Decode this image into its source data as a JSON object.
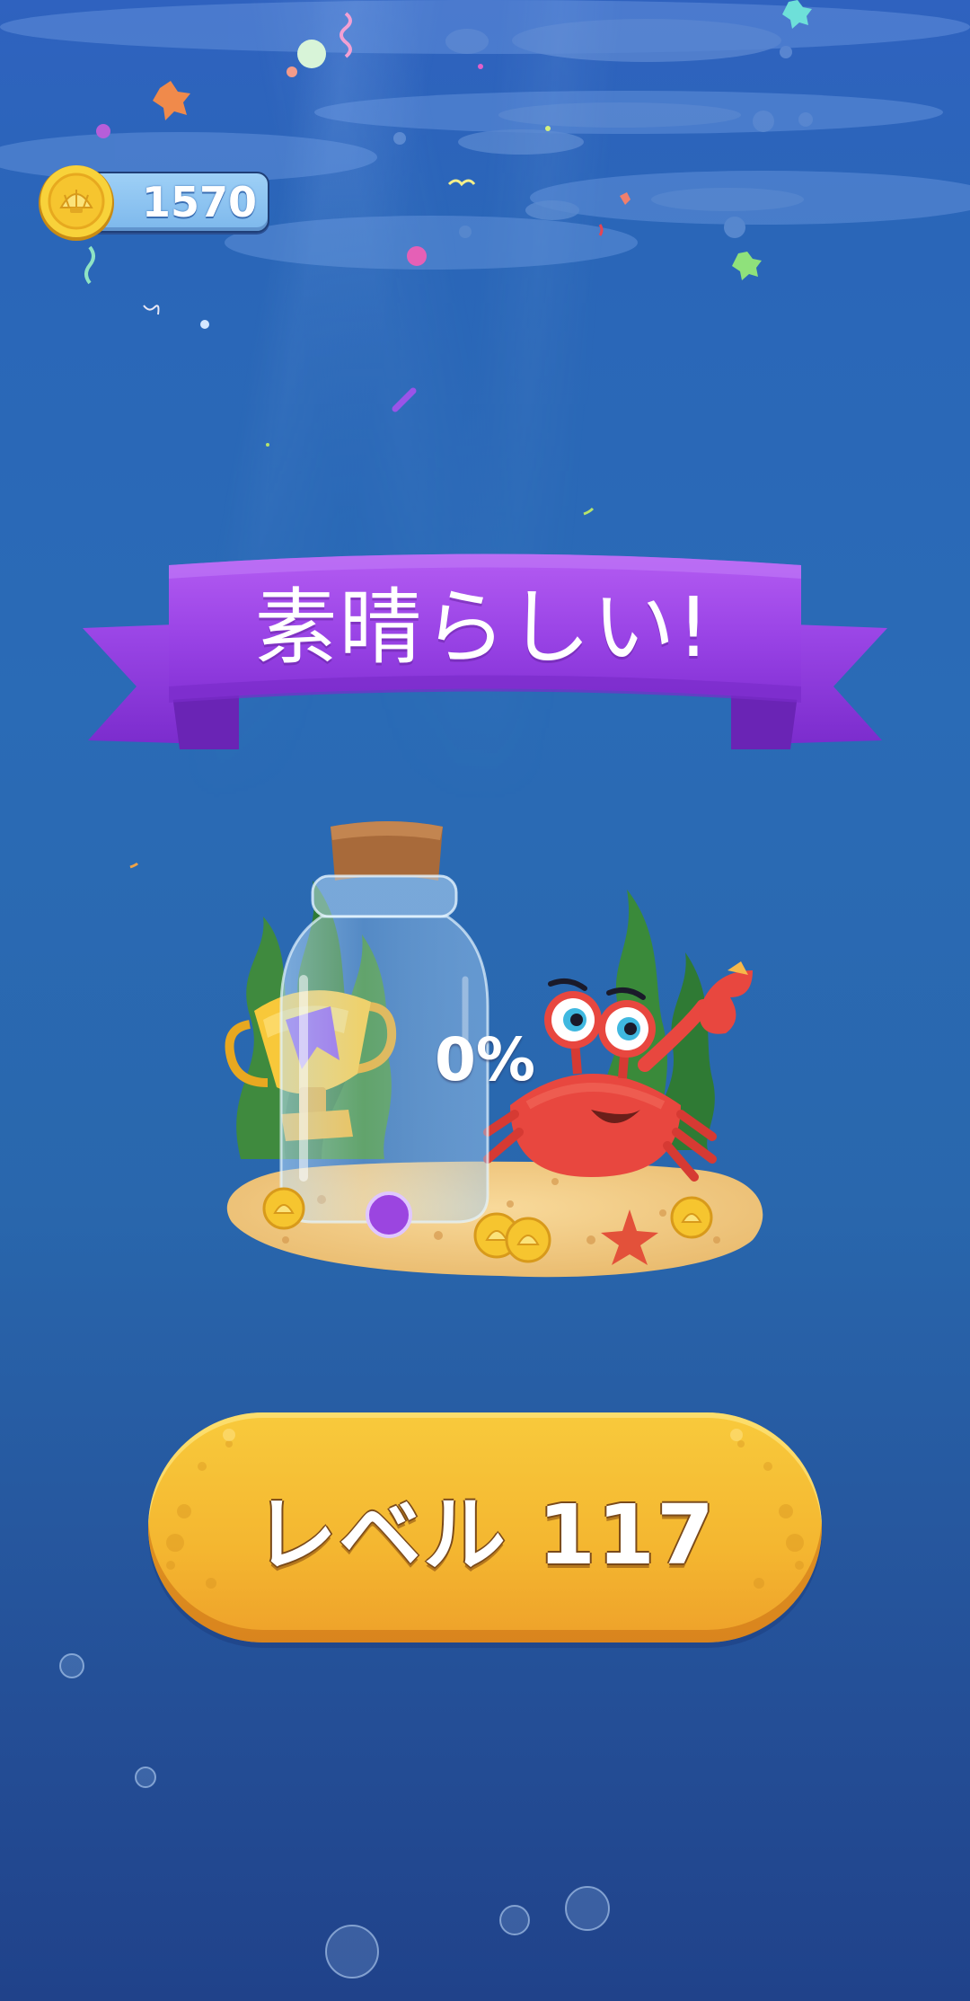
{
  "hud": {
    "coins": "1570",
    "coin_icon": "shell-coin-icon"
  },
  "banner": {
    "title": "素晴らしい!"
  },
  "reward": {
    "progress_label": "0%",
    "progress_fraction": 0.0,
    "illustration": "bottle-crab-trophy-scene"
  },
  "actions": {
    "level_button_label": "レベル 117"
  },
  "colors": {
    "background_top": "#2f62bf",
    "background_bottom": "#20428a",
    "ribbon_purple": "#9b45e8",
    "button_yellow": "#f4b630",
    "coin_gold": "#f6c52f",
    "crab_red": "#e8473f"
  }
}
